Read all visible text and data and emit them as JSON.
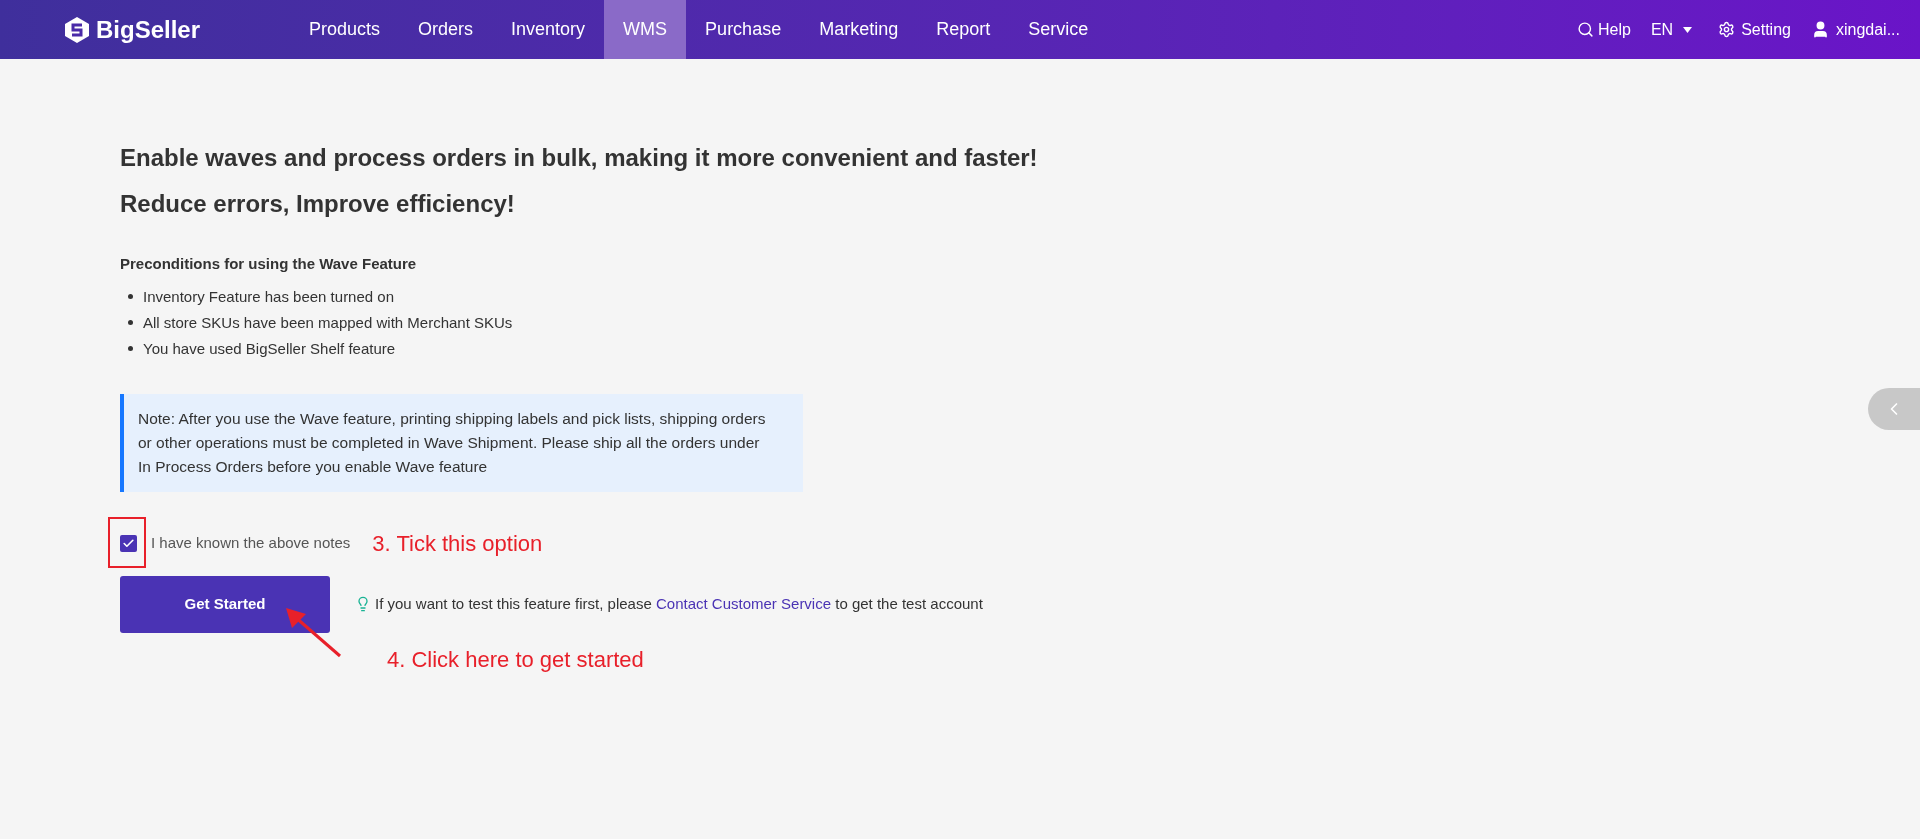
{
  "header": {
    "logo": "BigSeller",
    "nav": [
      {
        "label": "Products",
        "selected": false
      },
      {
        "label": "Orders",
        "selected": false
      },
      {
        "label": "Inventory",
        "selected": false
      },
      {
        "label": "WMS",
        "selected": true
      },
      {
        "label": "Purchase",
        "selected": false
      },
      {
        "label": "Marketing",
        "selected": false
      },
      {
        "label": "Report",
        "selected": false
      },
      {
        "label": "Service",
        "selected": false
      }
    ],
    "help": "Help",
    "language": "EN",
    "setting": "Setting",
    "user": "xingdai..."
  },
  "headings": [
    "Enable waves and process orders in bulk, making it more convenient and faster!",
    "Reduce errors, Improve efficiency!"
  ],
  "preconditions": {
    "title": "Preconditions for using the Wave Feature",
    "items": [
      "Inventory Feature has been turned on",
      "All store SKUs have been mapped with Merchant SKUs",
      "You have used BigSeller Shelf feature"
    ]
  },
  "note": "Note: After you use the Wave feature, printing shipping labels and pick lists, shipping orders or other operations must be completed in Wave Shipment. Please ship all the orders under In Process Orders before you enable Wave feature",
  "agreement": {
    "label": "I have known the above notes",
    "checked": true
  },
  "start_button": "Get Started",
  "tip": {
    "before": "If you want to test this feature first, please",
    "link": "Contact Customer Service",
    "after": "to get the test account"
  },
  "annotations": [
    "3. Tick this option",
    "4. Click here to get started"
  ]
}
